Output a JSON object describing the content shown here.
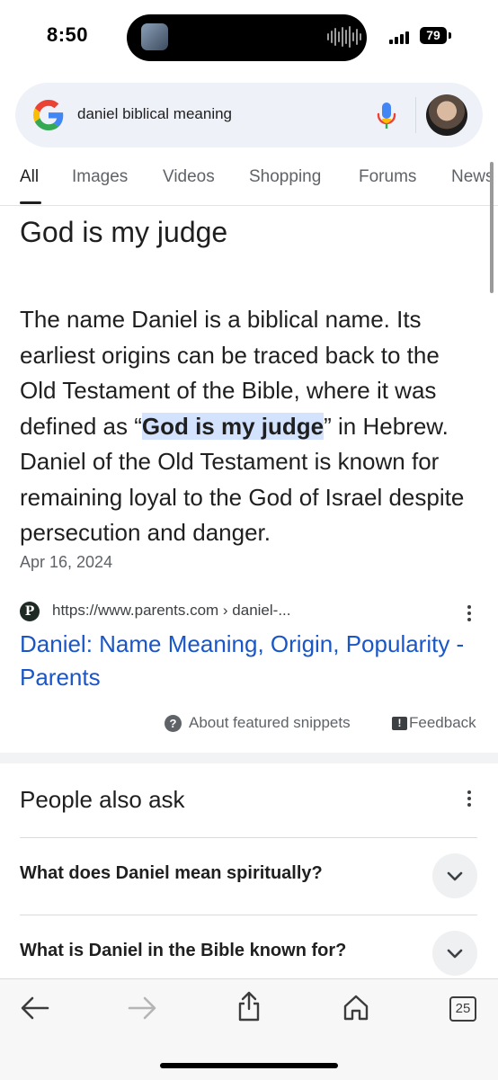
{
  "status_bar": {
    "time": "8:50",
    "battery": "79"
  },
  "search": {
    "query": "daniel biblical meaning"
  },
  "tabs": [
    {
      "label": "All",
      "active": true
    },
    {
      "label": "Images"
    },
    {
      "label": "Videos"
    },
    {
      "label": "Shopping"
    },
    {
      "label": "Forums"
    },
    {
      "label": "News"
    }
  ],
  "snippet": {
    "answer": "God is my judge",
    "text_before": "The name Daniel is a biblical name. Its earliest origins can be traced back to the Old Testament of the Bible, where it was defined as “",
    "highlight": "God is my judge",
    "text_after": "” in Hebrew. Daniel of the Old Testament is known for remaining loyal to the God of Israel despite persecution and danger.",
    "date": "Apr 16, 2024",
    "site_letter": "P",
    "url": "https://www.parents.com › daniel-...",
    "title": "Daniel: Name Meaning, Origin, Popularity - Parents",
    "about_label": "About featured snippets",
    "feedback_label": "Feedback"
  },
  "people_also_ask": {
    "title": "People also ask",
    "questions": [
      "What does Daniel mean spiritually?",
      "What is Daniel in the Bible known for?"
    ]
  },
  "bottom_bar": {
    "tab_count": "25"
  },
  "colors": {
    "link": "#1a56c8",
    "highlight": "#d3e3fd",
    "search_bg": "#eef2f8"
  }
}
